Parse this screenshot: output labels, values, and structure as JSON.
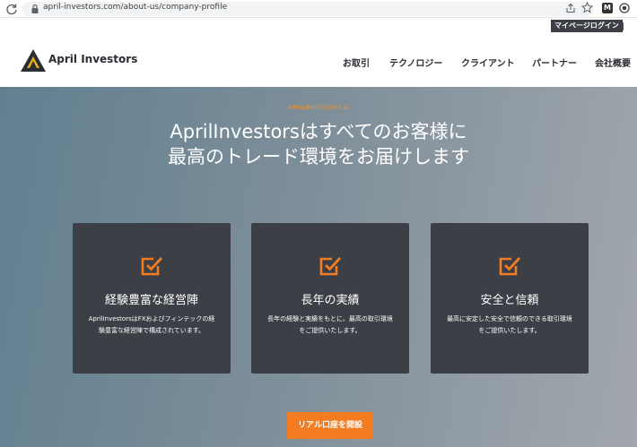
{
  "browser": {
    "url": "april-investors.com/about-us/company-profile"
  },
  "header": {
    "mypage_label": "マイページログイン",
    "logo_text": "April Investors",
    "nav": [
      {
        "label": "お取引"
      },
      {
        "label": "テクノロジー"
      },
      {
        "label": "クライアント"
      },
      {
        "label": "パートナー"
      },
      {
        "label": "会社概要"
      }
    ]
  },
  "hero": {
    "eyebrow": "APRILINVESTORSとは",
    "title": "AprilInvestorsはすべてのお客様に最高のトレード環境をお届けします",
    "cta_label": "リアル口座を開設"
  },
  "cards": [
    {
      "title": "経験豊富な経営陣",
      "desc": "AprilInvestorsはFXおよびフィンテックの経験豊富な経営陣で構成されています。",
      "icon": "checkbox-icon"
    },
    {
      "title": "長年の実績",
      "desc": "長年の経験と実績をもとに、最高の取引環境をご提供いたします。",
      "icon": "checkbox-icon"
    },
    {
      "title": "安全と信頼",
      "desc": "最高に安定した安全で信頼のできる取引環境をご提供いたします。",
      "icon": "checkbox-icon"
    }
  ],
  "colors": {
    "accent": "#f47c20",
    "card_bg": "#3d3f46"
  }
}
